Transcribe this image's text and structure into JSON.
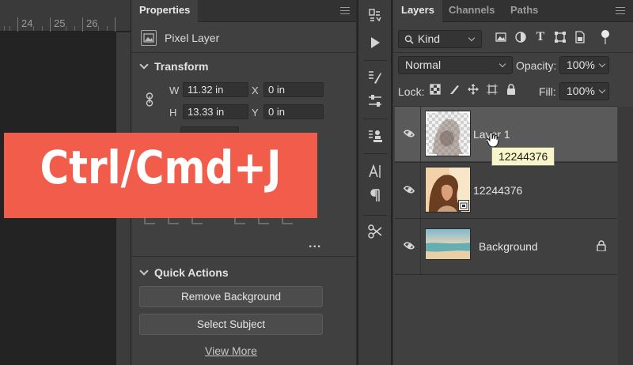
{
  "ruler": {
    "numbers": [
      "24",
      "25",
      "26"
    ]
  },
  "properties_panel": {
    "tab_label": "Properties",
    "layer_type": "Pixel Layer",
    "transform": {
      "title": "Transform",
      "w_label": "W",
      "w_value": "11.32 in",
      "h_label": "H",
      "h_value": "13.33 in",
      "x_label": "X",
      "x_value": "0 in",
      "y_label": "Y",
      "y_value": "0 in"
    },
    "quick_actions": {
      "title": "Quick Actions",
      "remove_background": "Remove Background",
      "select_subject": "Select Subject",
      "view_more": "View More"
    },
    "more": "..."
  },
  "overlay": {
    "shortcut": "Ctrl/Cmd+J",
    "color": "#f25c4b"
  },
  "layers_panel": {
    "tabs": [
      "Layers",
      "Channels",
      "Paths"
    ],
    "filter_kind": "Kind",
    "blend_mode": "Normal",
    "opacity_label": "Opacity:",
    "opacity_value": "100%",
    "lock_label": "Lock:",
    "fill_label": "Fill:",
    "fill_value": "100%",
    "layers": [
      {
        "name": "Layer 1",
        "selected": true
      },
      {
        "name": "12244376",
        "selected": false
      },
      {
        "name": "Background",
        "selected": false,
        "locked": true
      }
    ],
    "tooltip": "12244376"
  },
  "tools": [
    "history-icon",
    "play-icon",
    "brush-settings-icon",
    "adjustments-icon",
    "clone-source-icon",
    "character-icon",
    "paragraph-icon",
    "tools-icon"
  ]
}
